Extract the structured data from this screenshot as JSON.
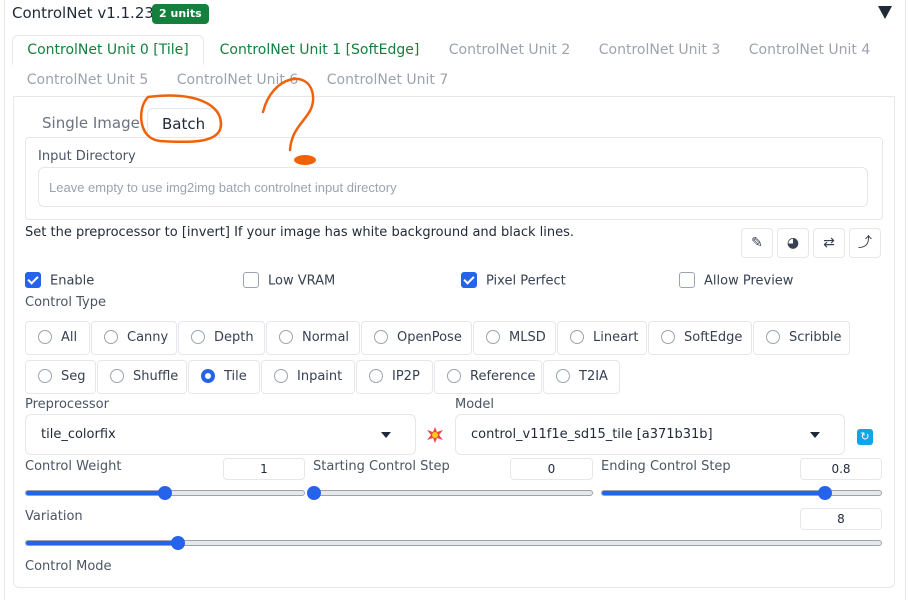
{
  "header": {
    "title": "ControlNet v1.1.238",
    "badge": "2 units"
  },
  "unit_tabs": [
    "ControlNet Unit 0 [Tile]",
    "ControlNet Unit 1 [SoftEdge]",
    "ControlNet Unit 2",
    "ControlNet Unit 3",
    "ControlNet Unit 4",
    "ControlNet Unit 5",
    "ControlNet Unit 6",
    "ControlNet Unit 7"
  ],
  "input_tabs": {
    "single": "Single Image",
    "batch": "Batch"
  },
  "input_directory": {
    "label": "Input Directory",
    "value": "",
    "placeholder": "Leave empty to use img2img batch controlnet input directory"
  },
  "hint": "Set the preprocessor to [invert] If your image has white background and black lines.",
  "tool_icons": [
    "edit-icon",
    "camera-icon",
    "swap-icon",
    "rotate-icon"
  ],
  "checkboxes": {
    "enable": {
      "label": "Enable",
      "checked": true
    },
    "low_vram": {
      "label": "Low VRAM",
      "checked": false
    },
    "pixel_perfect": {
      "label": "Pixel Perfect",
      "checked": true
    },
    "allow_preview": {
      "label": "Allow Preview",
      "checked": false
    }
  },
  "control_type": {
    "label": "Control Type",
    "selected": "Tile",
    "options": [
      "All",
      "Canny",
      "Depth",
      "Normal",
      "OpenPose",
      "MLSD",
      "Lineart",
      "SoftEdge",
      "Scribble",
      "Seg",
      "Shuffle",
      "Tile",
      "Inpaint",
      "IP2P",
      "Reference",
      "T2IA"
    ]
  },
  "preprocessor": {
    "label": "Preprocessor",
    "value": "tile_colorfix"
  },
  "model": {
    "label": "Model",
    "value": "control_v11f1e_sd15_tile [a371b31b]"
  },
  "sliders": {
    "control_weight": {
      "label": "Control Weight",
      "value": "1",
      "fraction": 0.5
    },
    "starting_step": {
      "label": "Starting Control Step",
      "value": "0",
      "fraction": 0.0
    },
    "ending_step": {
      "label": "Ending Control Step",
      "value": "0.8",
      "fraction": 0.8
    },
    "variation": {
      "label": "Variation",
      "value": "8",
      "fraction": 0.178
    }
  },
  "control_mode": {
    "label": "Control Mode"
  },
  "colors": {
    "accent": "#2563eb",
    "badge": "#15803d",
    "annotation": "#f0620a"
  }
}
